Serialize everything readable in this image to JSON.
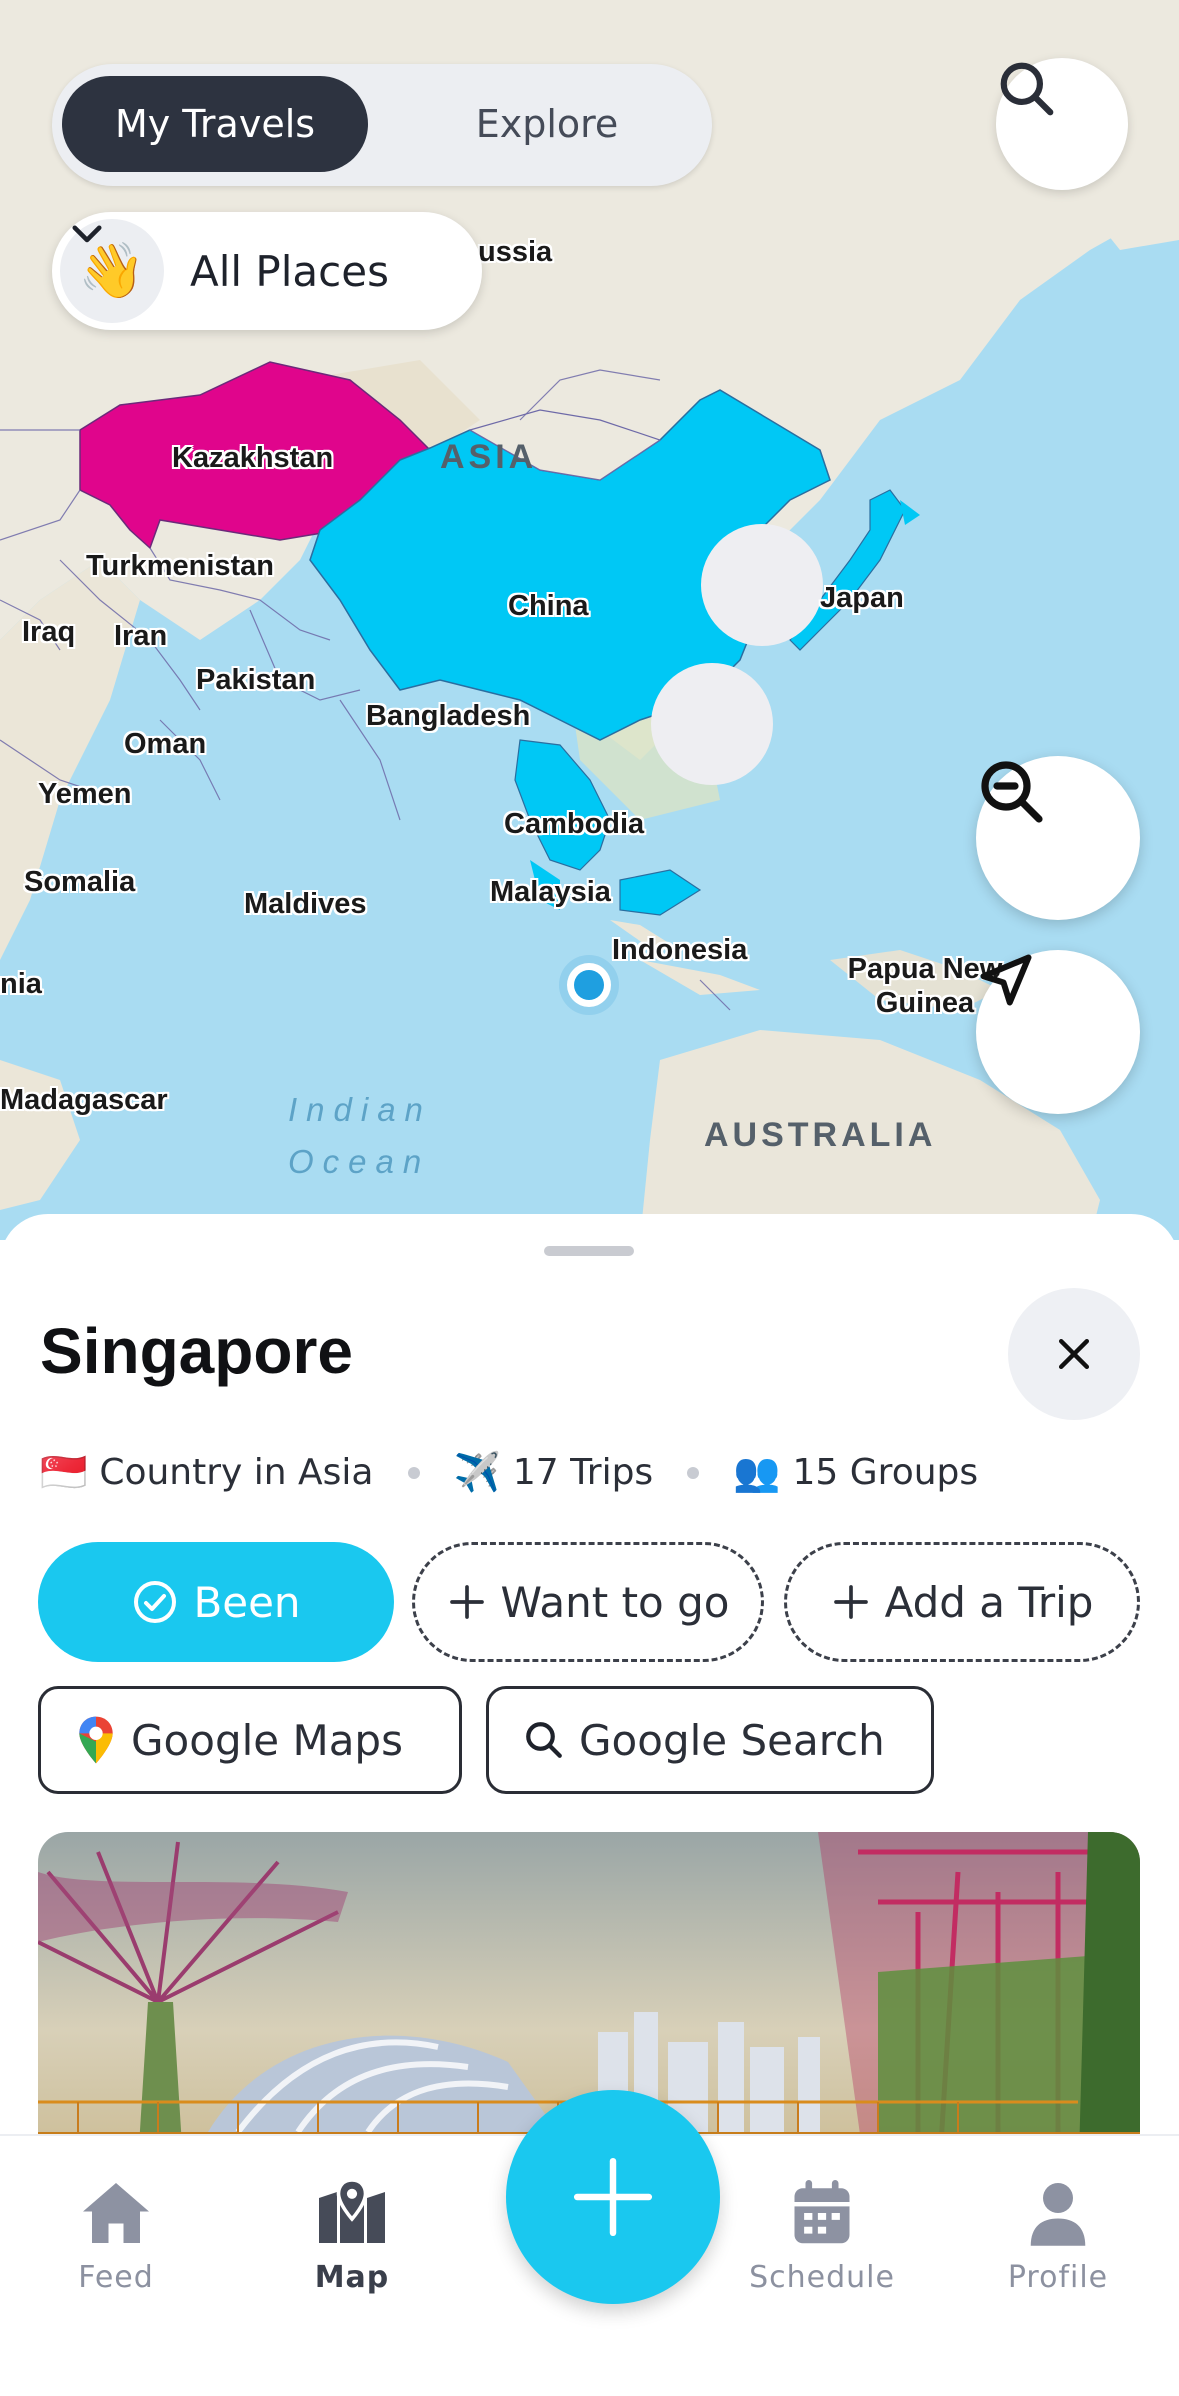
{
  "toggle": {
    "active": "My Travels",
    "inactive": "Explore"
  },
  "filter": {
    "emoji": "👋",
    "label": "All Places"
  },
  "map": {
    "labels": {
      "russia": "ussia",
      "kazakhstan": "Kazakhstan",
      "asia": "ASIA",
      "turkmenistan": "Turkmenistan",
      "iraq": "Iraq",
      "iran": "Iran",
      "china": "China",
      "japan": "Japan",
      "pakistan": "Pakistan",
      "bangladesh": "Bangladesh",
      "oman": "Oman",
      "yemen": "Yemen",
      "cambodia": "Cambodia",
      "somalia": "Somalia",
      "maldives": "Maldives",
      "malaysia": "Malaysia",
      "indonesia": "Indonesia",
      "png": "Papua New Guinea",
      "nia": "nia",
      "madagascar": "Madagascar",
      "indian_ocean": "Indian Ocean",
      "australia": "AUSTRALIA"
    },
    "colors": {
      "been": "#00c8f5",
      "want_to_go": "#e0058c",
      "ocean": "#a6dcf2",
      "land": "#ece9df"
    }
  },
  "place": {
    "title": "Singapore",
    "flag": "🇸🇬",
    "country_text": "Country in Asia",
    "trips": "17 Trips",
    "groups": "15 Groups"
  },
  "actions": {
    "been": "Been",
    "want_to_go": "Want to go",
    "add_trip": "Add a Trip",
    "google_maps": "Google Maps",
    "google_search": "Google Search"
  },
  "nav": {
    "feed": "Feed",
    "map": "Map",
    "schedule": "Schedule",
    "profile": "Profile",
    "active": "Map"
  },
  "accent": "#1ac8ef"
}
